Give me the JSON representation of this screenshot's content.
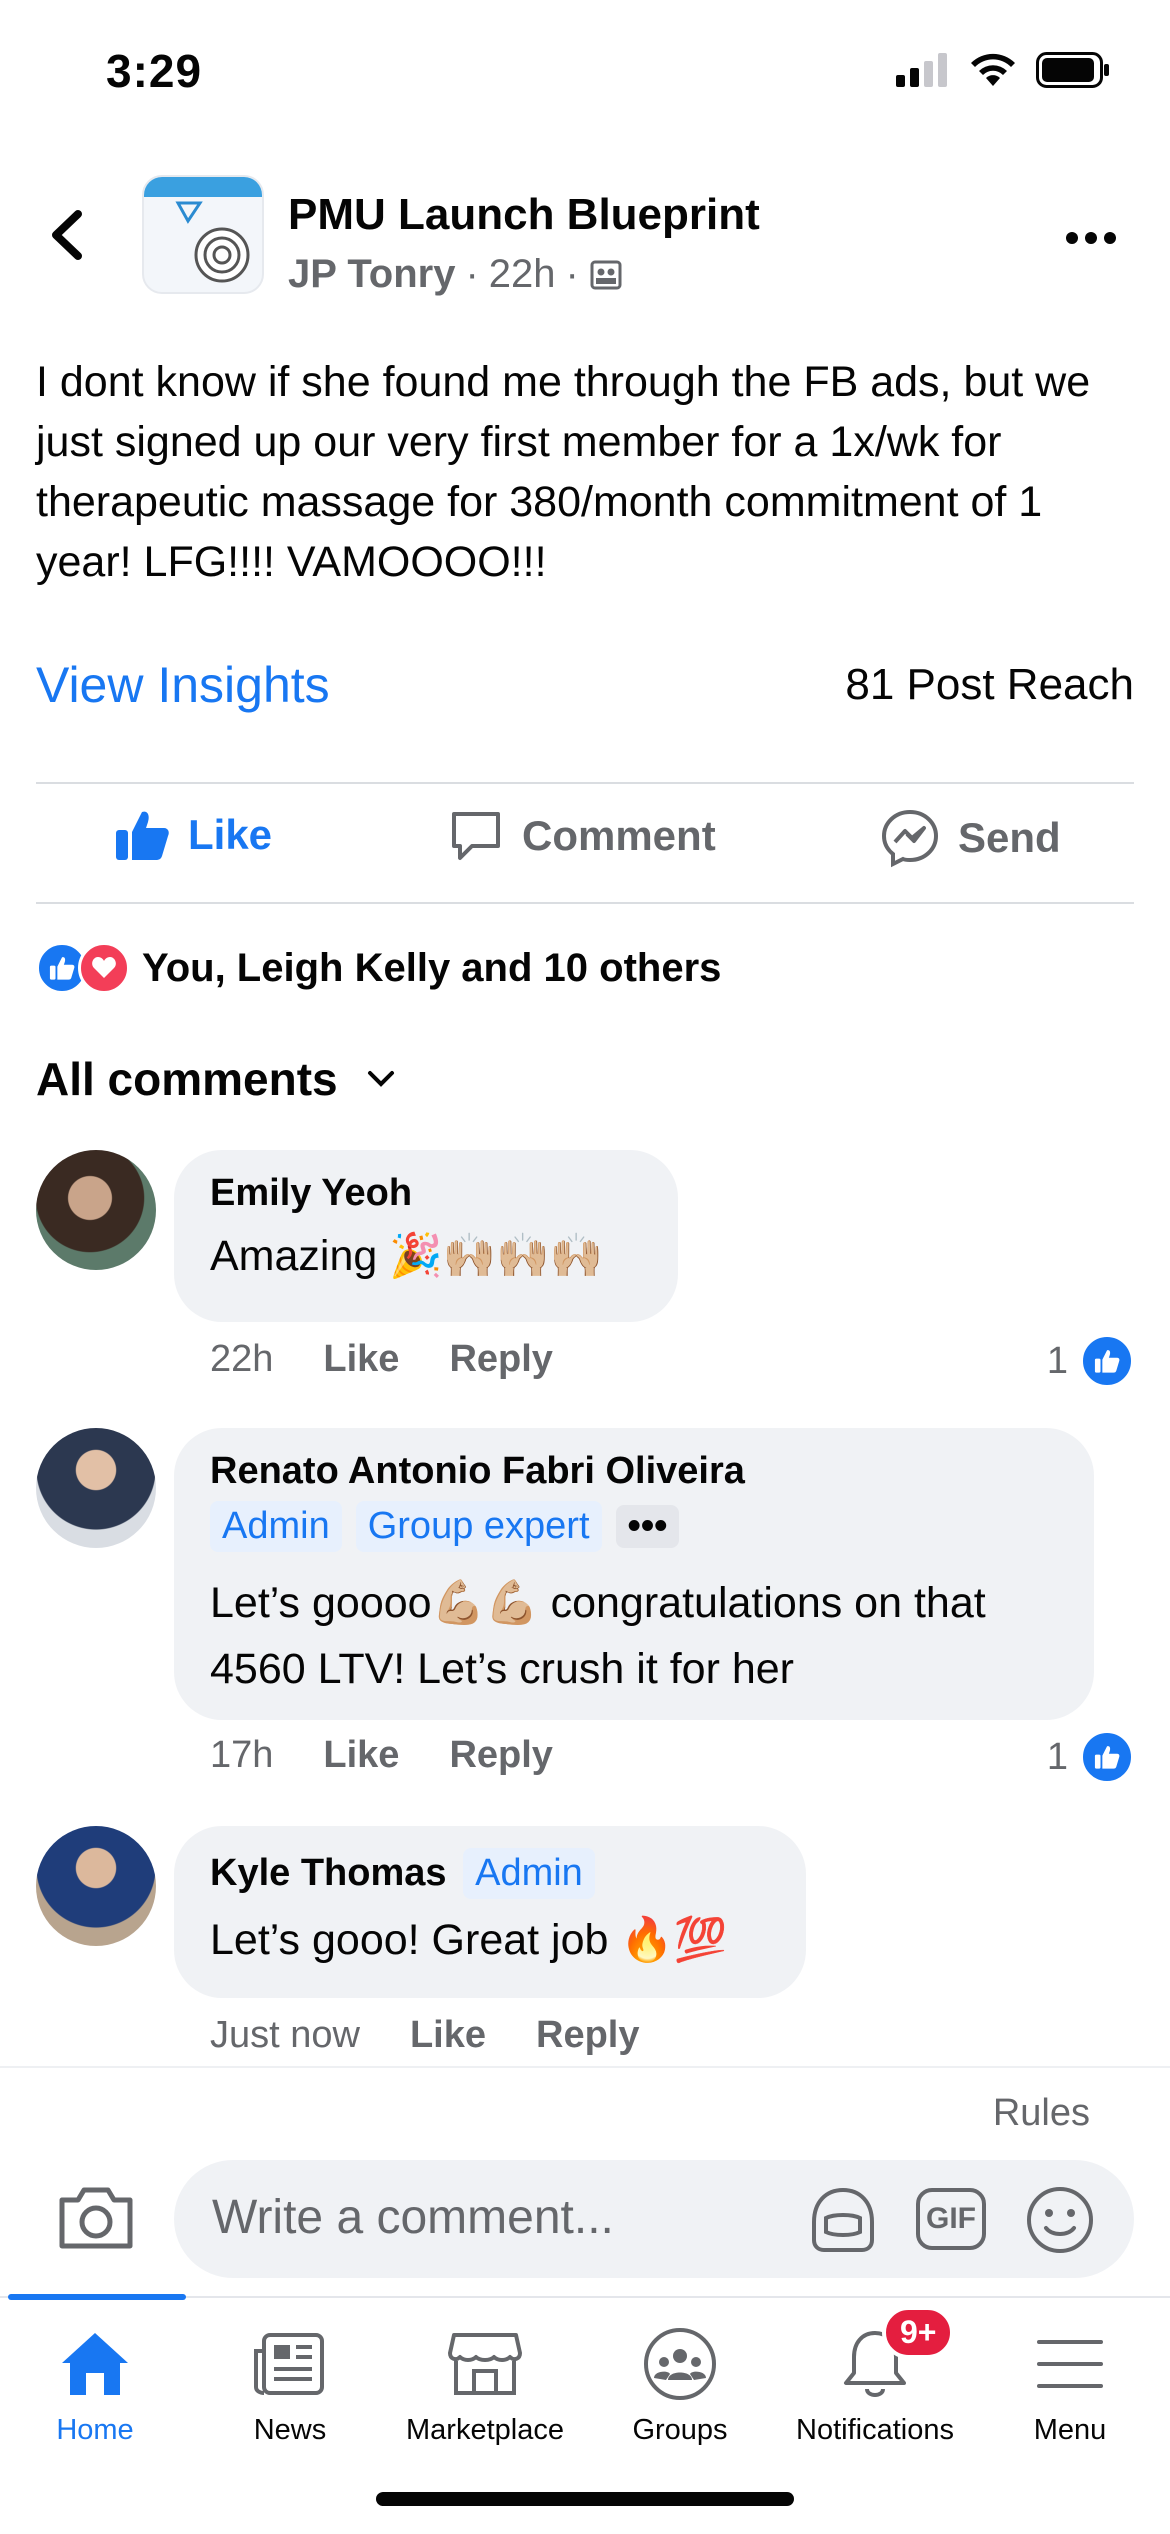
{
  "status": {
    "time": "3:29"
  },
  "header": {
    "group_name": "PMU Launch Blueprint",
    "author": "JP Tonry",
    "age": "22h",
    "sep": "·"
  },
  "post": {
    "text": "I dont know if she found me through the FB ads, but we just signed up our very first member for a 1x/wk for therapeutic massage for 380/month commitment of 1 year! LFG!!!! VAMOOOO!!!",
    "view_insights": "View Insights",
    "reach": "81 Post Reach"
  },
  "actions": {
    "like": "Like",
    "comment": "Comment",
    "send": "Send"
  },
  "reactions": {
    "summary": "You, Leigh Kelly and 10 others"
  },
  "comments_header": {
    "label": "All comments"
  },
  "comments": [
    {
      "name": "Emily Yeoh",
      "text": "Amazing 🎉🙌🏼🙌🏼🙌🏼",
      "time": "22h",
      "like": "Like",
      "reply": "Reply",
      "likes": "1"
    },
    {
      "name": "Renato Antonio Fabri Oliveira",
      "badges": [
        "Admin",
        "Group expert"
      ],
      "text": "Let’s goooo💪🏼💪🏼 congratulations on that 4560 LTV! Let’s crush it for her",
      "time": "17h",
      "like": "Like",
      "reply": "Reply",
      "likes": "1"
    },
    {
      "name": "Kyle Thomas",
      "badge": "Admin",
      "text": "Let’s gooo! Great job 🔥💯",
      "time": "Just now",
      "like": "Like",
      "reply": "Reply"
    }
  ],
  "composer": {
    "rules": "Rules",
    "placeholder": "Write a comment...",
    "gif": "GIF"
  },
  "tabs": [
    {
      "label": "Home"
    },
    {
      "label": "News"
    },
    {
      "label": "Marketplace"
    },
    {
      "label": "Groups"
    },
    {
      "label": "Notifications",
      "badge": "9+"
    },
    {
      "label": "Menu"
    }
  ],
  "colors": {
    "accent": "#1877f2",
    "secondary_text": "#65676b",
    "bubble": "#f0f2f5",
    "love": "#f33e58",
    "badge_red": "#e41e3f"
  }
}
